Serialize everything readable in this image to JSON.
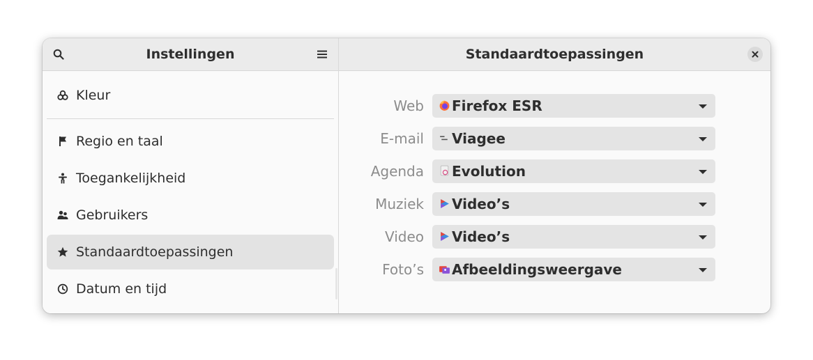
{
  "sidebar": {
    "title": "Instellingen",
    "items": [
      {
        "label": "Kleur",
        "icon": "color-icon"
      },
      {
        "label": "Regio en taal",
        "icon": "flag-icon"
      },
      {
        "label": "Toegankelijkheid",
        "icon": "accessibility-icon"
      },
      {
        "label": "Gebruikers",
        "icon": "users-icon"
      },
      {
        "label": "Standaardtoepassingen",
        "icon": "star-icon",
        "selected": true
      },
      {
        "label": "Datum en tijd",
        "icon": "clock-icon"
      }
    ]
  },
  "content": {
    "title": "Standaardtoepassingen",
    "apps": [
      {
        "label": "Web",
        "value": "Firefox ESR",
        "icon": "firefox-icon"
      },
      {
        "label": "E-mail",
        "value": "Viagee",
        "icon": "viagee-icon"
      },
      {
        "label": "Agenda",
        "value": "Evolution",
        "icon": "evolution-icon"
      },
      {
        "label": "Muziek",
        "value": "Video’s",
        "icon": "videos-icon"
      },
      {
        "label": "Video",
        "value": "Video’s",
        "icon": "videos-icon"
      },
      {
        "label": "Foto’s",
        "value": "Afbeeldingsweergave",
        "icon": "image-viewer-icon"
      }
    ]
  },
  "colors": {
    "header_bg": "#ebebeb",
    "window_bg": "#fafafa",
    "selected_row": "#e3e3e3",
    "dropdown_bg": "#e4e4e4",
    "label_gray": "#8c8c8c",
    "text": "#2e2e2e"
  }
}
